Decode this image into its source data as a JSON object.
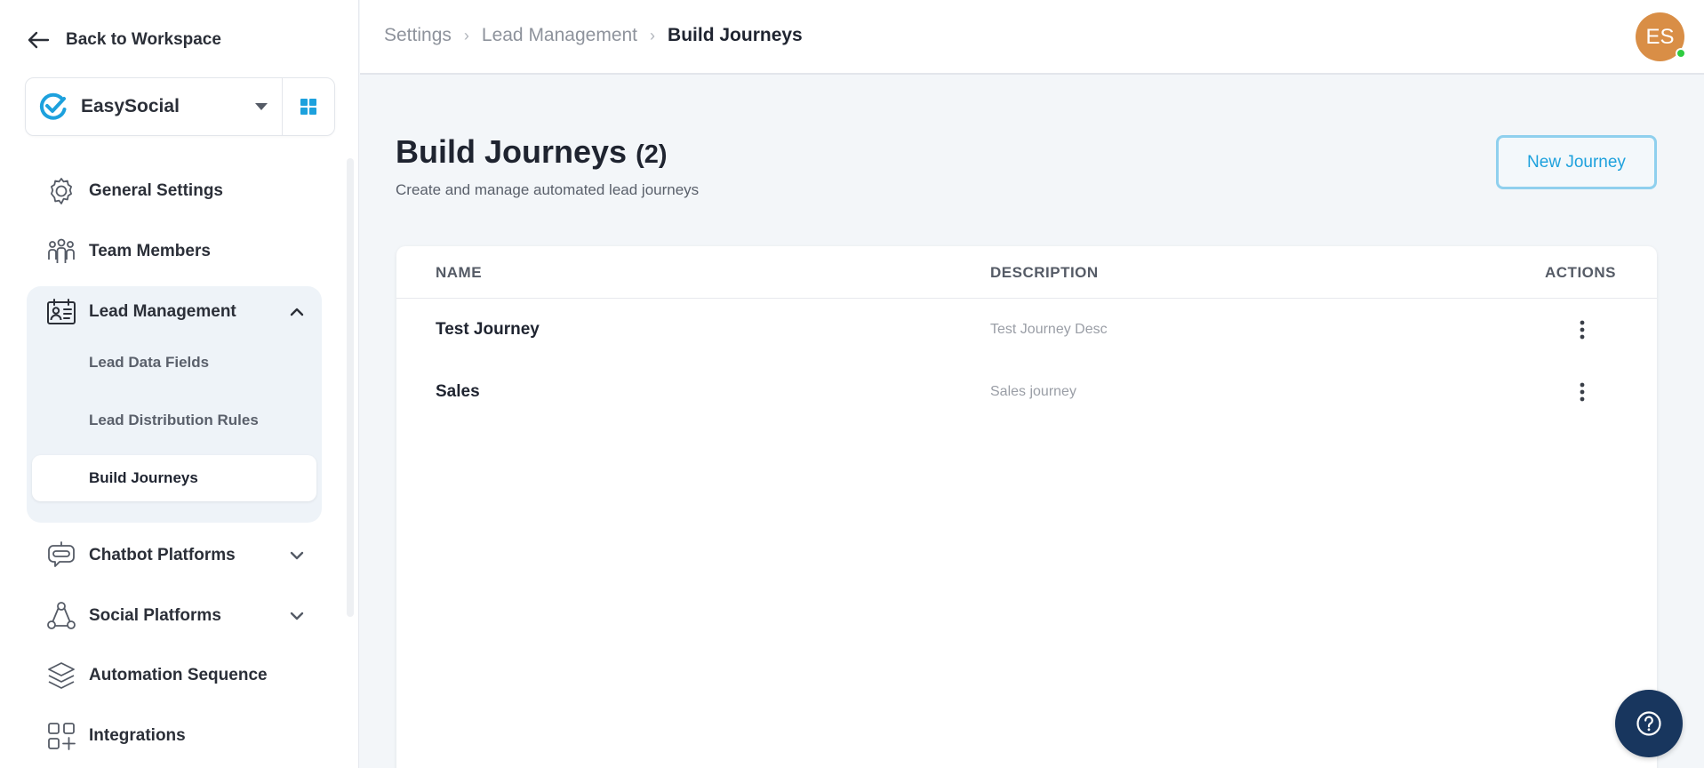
{
  "sidebar": {
    "back_label": "Back to Workspace",
    "workspace_name": "EasySocial",
    "nav": {
      "general_settings": "General Settings",
      "team_members": "Team Members",
      "lead_management": "Lead Management",
      "lead_data_fields": "Lead Data Fields",
      "lead_distribution_rules": "Lead Distribution Rules",
      "build_journeys": "Build Journeys",
      "chatbot_platforms": "Chatbot Platforms",
      "social_platforms": "Social Platforms",
      "automation_sequence": "Automation Sequence",
      "integrations": "Integrations"
    }
  },
  "header": {
    "breadcrumb": [
      "Settings",
      "Lead Management",
      "Build Journeys"
    ],
    "avatar_initials": "ES"
  },
  "main": {
    "title": "Build Journeys",
    "count": "(2)",
    "subtitle": "Create and manage automated lead journeys",
    "new_button": "New Journey",
    "columns": {
      "name": "NAME",
      "description": "DESCRIPTION",
      "actions": "ACTIONS"
    },
    "rows": [
      {
        "name": "Test Journey",
        "description": "Test Journey Desc"
      },
      {
        "name": "Sales",
        "description": "Sales journey"
      }
    ]
  },
  "colors": {
    "accent": "#1da1dd",
    "help_button": "#18365e",
    "avatar": "#d98e46",
    "online": "#2ecc40"
  },
  "icons": {
    "back": "arrow-left-icon",
    "workspace_logo": "easysocial-logo",
    "apps_grid": "grid-icon",
    "general_settings": "gear-icon",
    "team_members": "people-icon",
    "lead_management": "contact-card-icon",
    "chatbot_platforms": "chatbot-icon",
    "social_platforms": "network-icon",
    "automation_sequence": "layers-icon",
    "integrations": "apps-add-icon",
    "help": "question-icon",
    "row_actions": "kebab-menu-icon"
  }
}
